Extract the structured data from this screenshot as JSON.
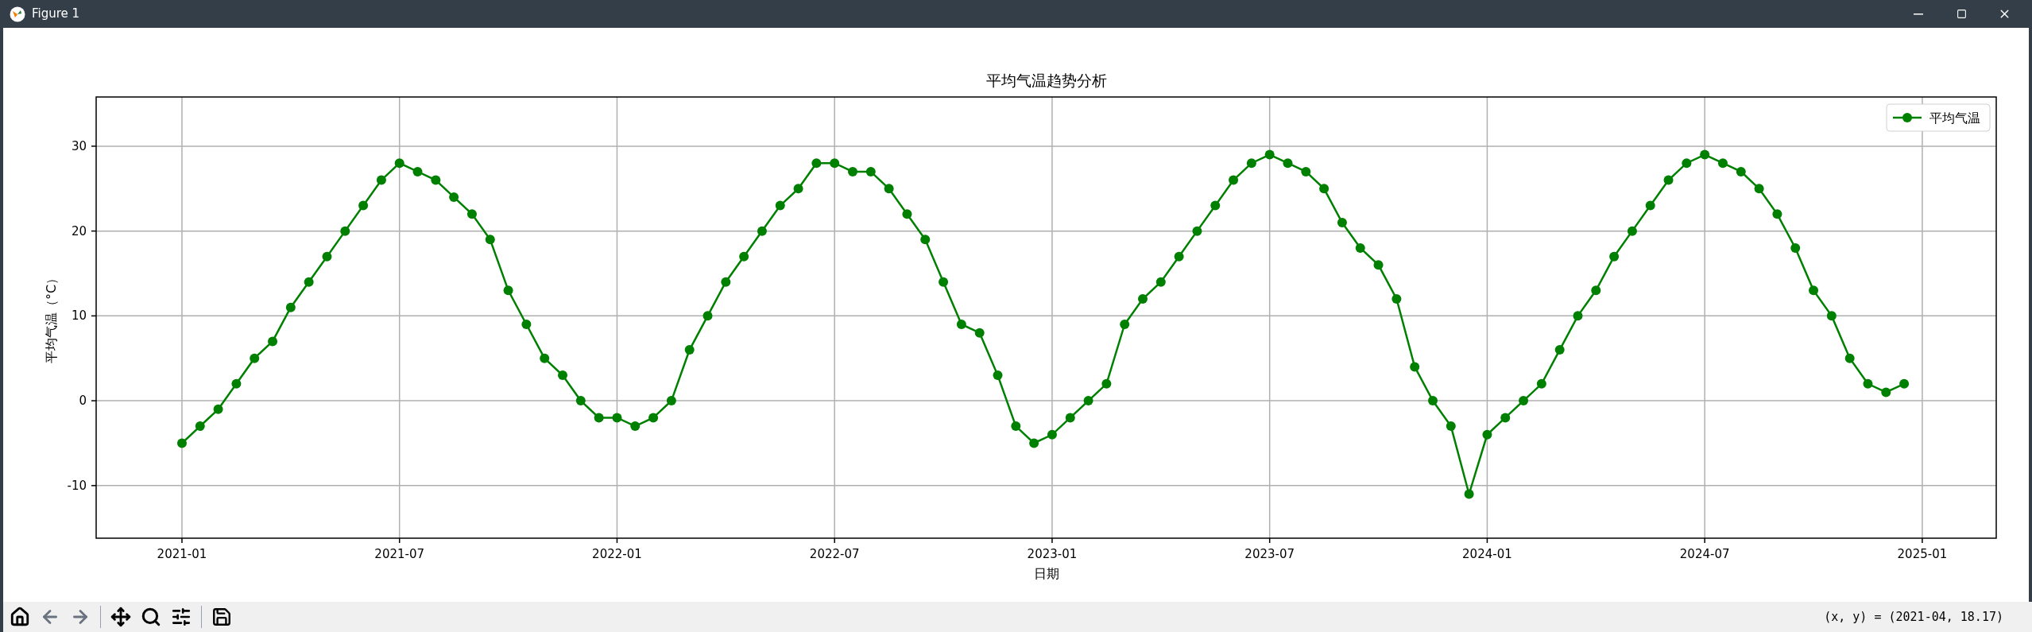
{
  "window": {
    "title": "Figure 1"
  },
  "figure": {
    "chart_data": {
      "type": "line",
      "grid": true,
      "title": "平均气温趋势分析",
      "xlabel": "日期",
      "ylabel": "平均气温（°C）",
      "categories": [
        "2021-01",
        null,
        null,
        null,
        null,
        null,
        null,
        null,
        null,
        null,
        null,
        null,
        "2021-07",
        null,
        null,
        null,
        null,
        null,
        null,
        null,
        null,
        null,
        null,
        null,
        "2022-01",
        null,
        null,
        null,
        null,
        null,
        null,
        null,
        null,
        null,
        null,
        null,
        "2022-07",
        null,
        null,
        null,
        null,
        null,
        null,
        null,
        null,
        null,
        null,
        null,
        "2023-01",
        null,
        null,
        null,
        null,
        null,
        null,
        null,
        null,
        null,
        null,
        null,
        "2023-07",
        null,
        null,
        null,
        null,
        null,
        null,
        null,
        null,
        null,
        null,
        null,
        "2024-01",
        null,
        null,
        null,
        null,
        null,
        null,
        null,
        null,
        null,
        null,
        null,
        "2024-07",
        null,
        null,
        null,
        null,
        null,
        null,
        null,
        null,
        null,
        null,
        null,
        "2025-01"
      ],
      "series": [
        {
          "name": "平均气温",
          "color": "#008000",
          "marker": "o",
          "values": [
            -5,
            -3,
            -1,
            2,
            5,
            7,
            11,
            14,
            17,
            20,
            23,
            26,
            28,
            27,
            26,
            24,
            22,
            19,
            13,
            9,
            5,
            3,
            0,
            -2,
            -2,
            -3,
            -2,
            0,
            6,
            10,
            14,
            17,
            20,
            23,
            25,
            28,
            28,
            27,
            27,
            25,
            22,
            19,
            14,
            9,
            8,
            3,
            -3,
            -5,
            -4,
            -2,
            0,
            2,
            9,
            12,
            14,
            17,
            20,
            23,
            26,
            28,
            29,
            28,
            27,
            25,
            21,
            18,
            16,
            12,
            4,
            0,
            -3,
            -11,
            -4,
            -2,
            0,
            2,
            6,
            10,
            13,
            17,
            20,
            23,
            26,
            28,
            29,
            28,
            27,
            25,
            22,
            18,
            13,
            10,
            5,
            2,
            1,
            2,
            null
          ]
        }
      ],
      "ylim": [
        -16.2,
        35.8
      ],
      "yticks": [
        -10,
        0,
        10,
        20,
        30
      ]
    }
  },
  "status_bar": {
    "text": "(x, y) = (2021-04, 18.17)"
  }
}
